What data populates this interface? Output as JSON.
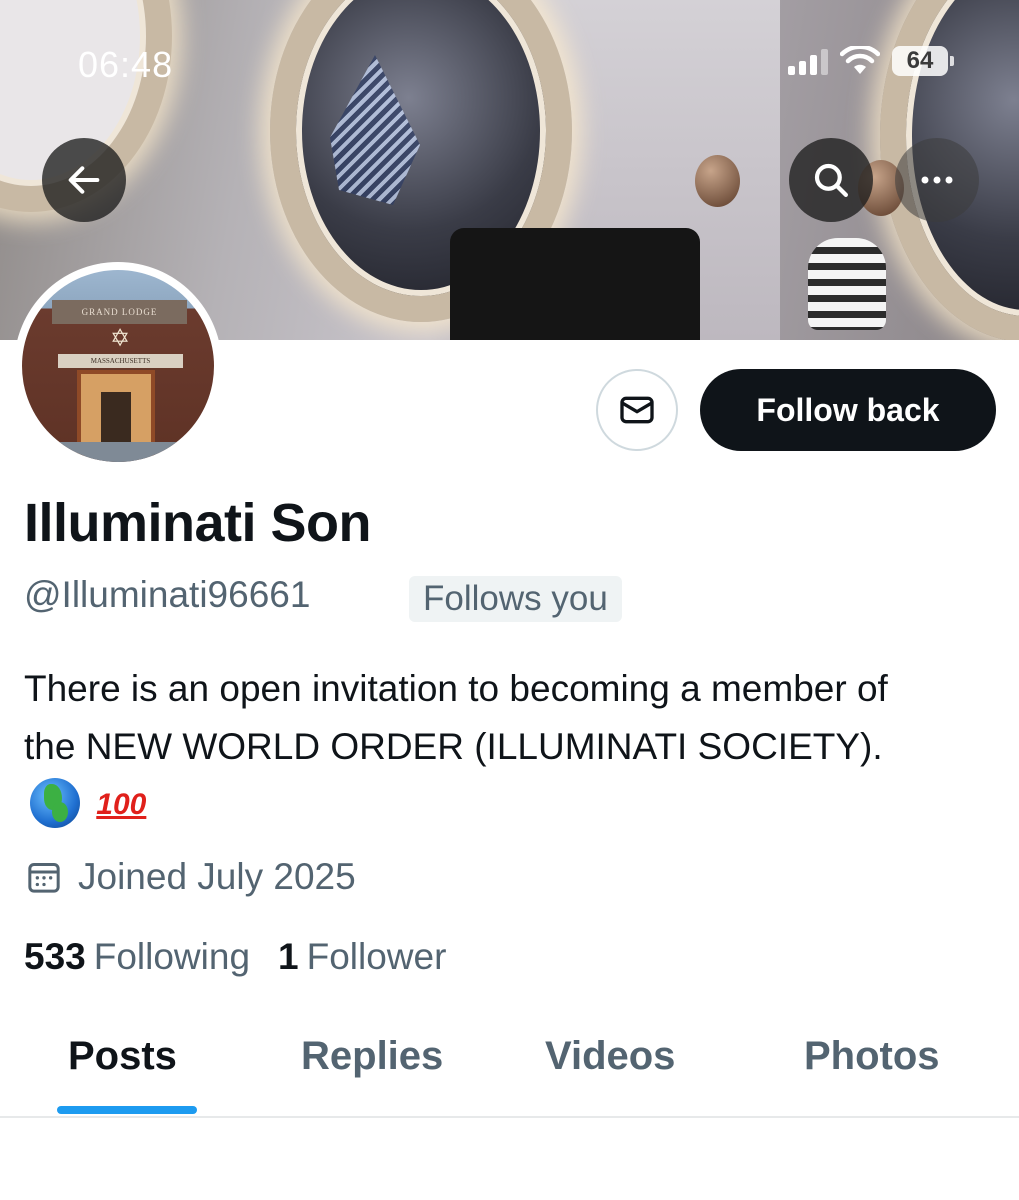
{
  "status_bar": {
    "time": "06:48",
    "battery": "64"
  },
  "profile": {
    "display_name": "Illuminati Son",
    "handle": "@Illuminati96661",
    "follows_you_badge": "Follows you",
    "bio": "There is an open invitation to becoming a member of the NEW WORLD ORDER (ILLUMINATI SOCIETY).",
    "joined": "Joined July 2025",
    "following_count": "533",
    "following_label": "Following",
    "followers_count": "1",
    "followers_label": "Follower",
    "avatar_sign_top": "GRAND LODGE",
    "avatar_sign_bottom": "MASSACHUSETTS"
  },
  "actions": {
    "follow_back": "Follow back"
  },
  "tabs": [
    {
      "label": "Posts",
      "active": true
    },
    {
      "label": "Replies",
      "active": false
    },
    {
      "label": "Videos",
      "active": false
    },
    {
      "label": "Photos",
      "active": false
    }
  ],
  "icons": {
    "back": "arrow-left-icon",
    "search": "search-icon",
    "more": "more-icon",
    "message": "envelope-icon",
    "calendar": "calendar-icon",
    "bio_emoji_1": "globe-europe-africa-emoji",
    "bio_emoji_2": "hundred-points-emoji"
  },
  "colors": {
    "accent": "#1d9bf0",
    "text": "#0f1419",
    "secondary": "#536471",
    "button_dark": "#0f1419"
  }
}
